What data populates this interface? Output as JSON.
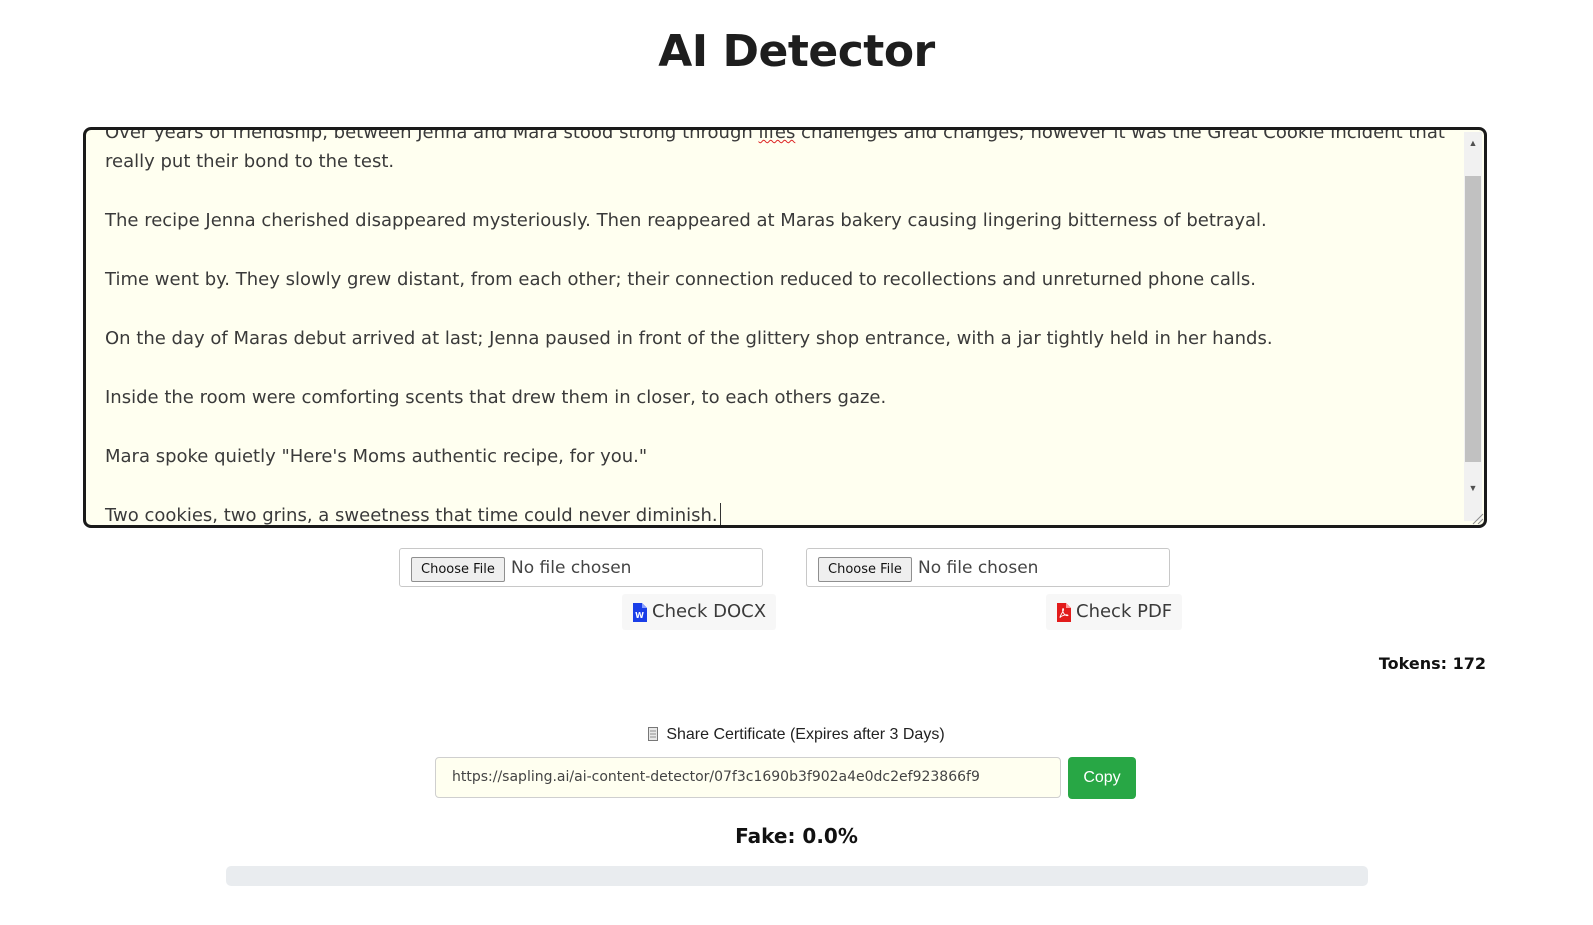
{
  "page": {
    "title": "AI Detector"
  },
  "editor": {
    "paragraphs": [
      {
        "before": "Over years of friendship, between Jenna and Mara stood strong through ",
        "misspelled": "lifes",
        "after": " challenges and changes; however it was the Great Cookie Incident that really put their bond to the test."
      },
      {
        "before": "The recipe Jenna cherished disappeared mysteriously. Then reappeared at Maras bakery causing lingering bitterness of betrayal.",
        "misspelled": "",
        "after": ""
      },
      {
        "before": "Time went by. They slowly grew distant, from each other; their connection reduced to recollections and unreturned phone calls.",
        "misspelled": "",
        "after": ""
      },
      {
        "before": "On the day of Maras debut arrived at last; Jenna paused in front of the glittery shop entrance, with a jar tightly held in her hands.",
        "misspelled": "",
        "after": ""
      },
      {
        "before": "Inside the room were comforting scents that drew them in closer, to each others gaze.",
        "misspelled": "",
        "after": ""
      },
      {
        "before": "Mara spoke quietly \"Here's Moms authentic recipe, for you.\"",
        "misspelled": "",
        "after": ""
      },
      {
        "before": "Two cookies, two grins, a sweetness that time could never diminish.",
        "misspelled": "",
        "after": ""
      }
    ],
    "background_color": "#fffff0"
  },
  "uploads": {
    "docx": {
      "choose_label": "Choose File",
      "status": "No file chosen",
      "check_label": "Check DOCX",
      "icon": "word-file-icon",
      "icon_color": "#1a3ee8"
    },
    "pdf": {
      "choose_label": "Choose File",
      "status": "No file chosen",
      "check_label": "Check PDF",
      "icon": "pdf-file-icon",
      "icon_color": "#e21b1b"
    }
  },
  "stats": {
    "tokens_label": "Tokens: 172",
    "tokens": 172
  },
  "share": {
    "label": "Share Certificate (Expires after 3 Days)",
    "icon": "document-icon",
    "url": "https://sapling.ai/ai-content-detector/07f3c1690b3f902a4e0dc2ef923866f9",
    "copy_label": "Copy",
    "copy_color": "#28a745"
  },
  "result": {
    "fake_label": "Fake: 0.0%",
    "fake_fraction": 0.0,
    "bar_track_color": "#e9ecef"
  }
}
